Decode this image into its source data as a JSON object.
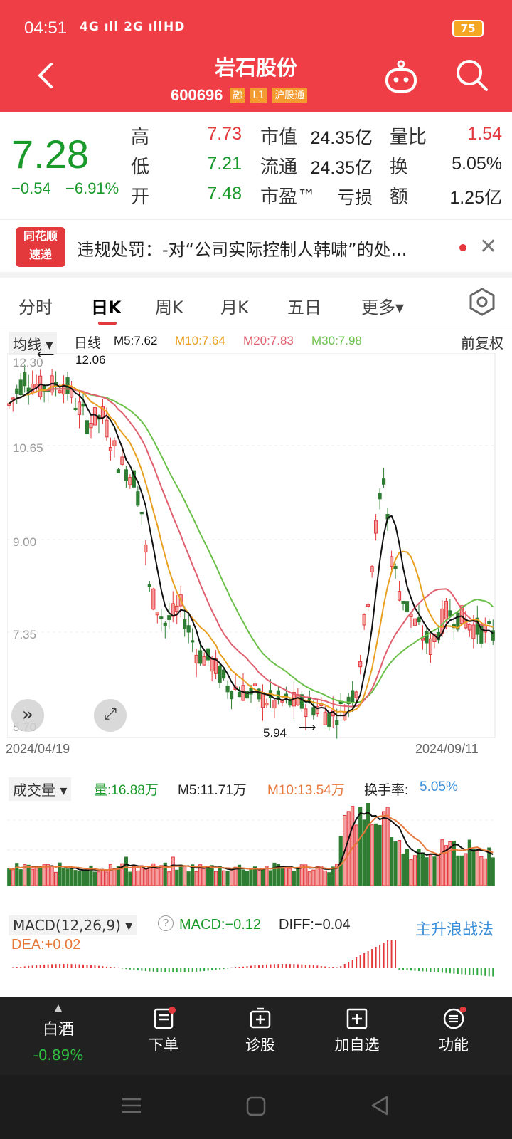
{
  "status": {
    "time": "04:51",
    "signal": "4G ıll 2G ıll",
    "net": "HD",
    "battery": "75"
  },
  "header": {
    "title": "岩石股份",
    "code": "600696",
    "tags": [
      "融",
      "L1",
      "沪股通"
    ]
  },
  "quote": {
    "price": "7.28",
    "change": "−0.54",
    "change_pct": "−6.91%",
    "rows": [
      {
        "l1": "高",
        "v1": "7.73",
        "l2": "市值",
        "v2": "24.35亿",
        "l3": "量比",
        "v3": "1.54"
      },
      {
        "l1": "低",
        "v1": "7.21",
        "l2": "流通",
        "v2": "24.35亿",
        "l3": "换",
        "v3": "5.05%"
      },
      {
        "l1": "开",
        "v1": "7.48",
        "l2": "市盈™",
        "v2": "亏损",
        "l3": "额",
        "v3": "1.25亿"
      }
    ]
  },
  "news": {
    "logo1": "同花顺",
    "logo2": "速递",
    "text": "违规处罚：-对“公司实际控制人韩啸”的处..."
  },
  "tabs": [
    "分时",
    "日K",
    "周K",
    "月K",
    "五日",
    "更多▾"
  ],
  "indicators": {
    "mode": "均线 ▾",
    "type": "日线",
    "ma5": "M5:7.62",
    "ma10": "M10:7.64",
    "ma20": "M20:7.83",
    "ma30": "M30:7.98",
    "adjust": "前复权"
  },
  "kline": {
    "y_labels": [
      "12.30",
      "10.65",
      "9.00",
      "7.35",
      "5.70"
    ],
    "high_label": "12.06",
    "low_label": "5.94",
    "start_date": "2024/04/19",
    "end_date": "2024/09/11"
  },
  "volume": {
    "title": "成交量 ▾",
    "vol": "量:16.88万",
    "m5": "M5:11.71万",
    "m10": "M10:13.54万",
    "turnover_label": "换手率:",
    "turnover": "5.05%"
  },
  "macd": {
    "title": "MACD(12,26,9) ▾",
    "help": "?",
    "macd": "MACD:−0.12",
    "diff": "DIFF:−0.04",
    "dea": "DEA:+0.02",
    "strategy": "主升浪战法"
  },
  "bottom": {
    "sector_name": "白酒",
    "sector_change": "-0.89%",
    "items": [
      "下单",
      "诊股",
      "加自选",
      "功能"
    ]
  },
  "colors": {
    "brand": "#ef3e46",
    "up": "#e4393c",
    "down": "#1a9a2a",
    "ma5": "#111111",
    "ma10": "#e8a020",
    "ma20": "#e06070",
    "ma30": "#6cc04a"
  }
}
